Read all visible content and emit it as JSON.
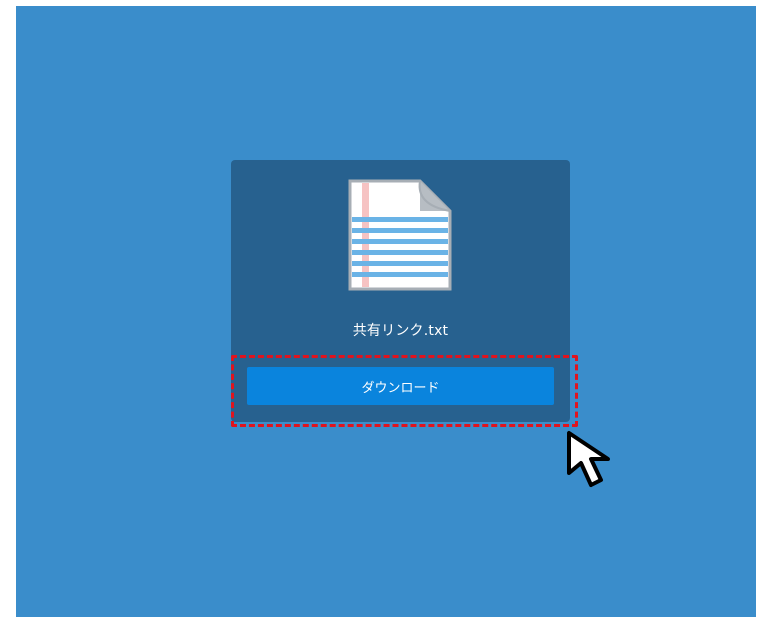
{
  "file": {
    "name": "共有リンク.txt",
    "icon": "text-document-icon"
  },
  "actions": {
    "download_label": "ダウンロード"
  },
  "annotations": {
    "highlight_color": "#e0141e",
    "cursor_icon": "mouse-pointer-icon"
  },
  "colors": {
    "background": "#3a8dcb",
    "card": "#27618f",
    "button": "#0a84dd"
  }
}
